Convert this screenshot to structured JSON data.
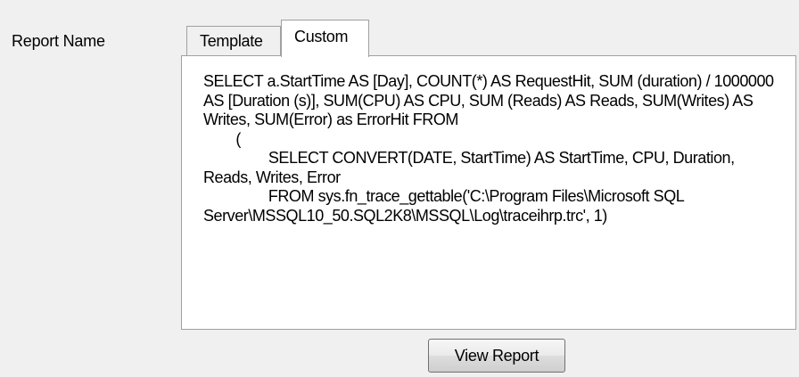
{
  "form": {
    "report_name_label": "Report Name"
  },
  "tabs": [
    {
      "label": "Template",
      "selected": false
    },
    {
      "label": "Custom",
      "selected": true
    }
  ],
  "query": {
    "value": "SELECT a.StartTime AS [Day], COUNT(*) AS RequestHit, SUM (duration) / 1000000  AS [Duration (s)], SUM(CPU) AS CPU, SUM (Reads) AS Reads, SUM(Writes) AS Writes, SUM(Error) as ErrorHit FROM\n\t(\n\t\tSELECT CONVERT(DATE, StartTime) AS StartTime, CPU, Duration, Reads, Writes, Error\n\t\tFROM sys.fn_trace_gettable('C:\\Program Files\\Microsoft SQL Server\\MSSQL10_50.SQL2K8\\MSSQL\\Log\\traceihrp.trc', 1)"
  },
  "actions": {
    "view_report_label": "View Report"
  }
}
